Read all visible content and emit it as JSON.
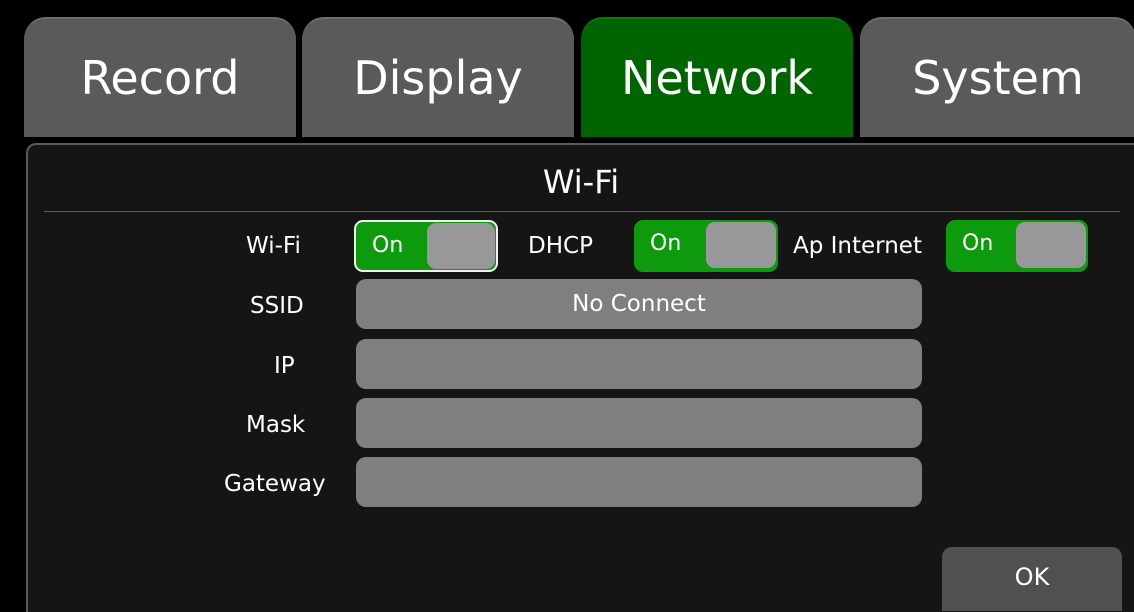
{
  "tabs": [
    {
      "label": "Record",
      "active": false
    },
    {
      "label": "Display",
      "active": false
    },
    {
      "label": "Network",
      "active": true
    },
    {
      "label": "System",
      "active": false
    }
  ],
  "panel": {
    "title": "Wi-Fi",
    "wifi": {
      "label": "Wi-Fi",
      "state": "On"
    },
    "dhcp": {
      "label": "DHCP",
      "state": "On"
    },
    "ap_internet": {
      "label": "Ap Internet",
      "state": "On"
    },
    "ssid": {
      "label": "SSID",
      "value": "No Connect"
    },
    "ip": {
      "label": "IP",
      "value": ""
    },
    "mask": {
      "label": "Mask",
      "value": ""
    },
    "gateway": {
      "label": "Gateway",
      "value": ""
    },
    "ok_label": "OK"
  },
  "colors": {
    "active_tab": "#006400",
    "inactive_tab": "#5a5a5a",
    "toggle_on": "#0d9a0d",
    "field": "#7f7f7f"
  }
}
